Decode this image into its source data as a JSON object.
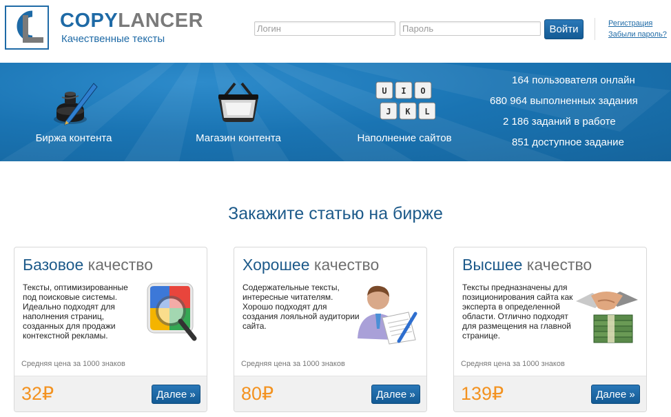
{
  "header": {
    "logo_part1": "COPY",
    "logo_part2": "LANCER",
    "tagline": "Качественные тексты",
    "login_placeholder": "Логин",
    "password_placeholder": "Пароль",
    "login_button": "Войти",
    "register_link": "Регистрация",
    "forgot_link": "Забыли пароль?"
  },
  "banner": {
    "features": [
      {
        "label": "Биржа контента",
        "icon": "inkwell-pen-icon"
      },
      {
        "label": "Магазин контента",
        "icon": "basket-icon"
      },
      {
        "label": "Наполнение сайтов",
        "icon": "keyboard-keys-icon"
      }
    ],
    "keys_top": [
      "U",
      "I",
      "O"
    ],
    "keys_bottom": [
      "J",
      "K",
      "L"
    ],
    "stats": [
      "164 пользователя онлайн",
      "680 964 выполненных задания",
      "2 186 заданий в работе",
      "851 доступное задание"
    ]
  },
  "section_title": "Закажите статью на бирже",
  "cards": [
    {
      "title_main": "Базовое",
      "title_rest": " качество",
      "description": "Тексты, оптимизированные под поисковые системы. Идеально подходят для наполнения страниц, созданных для продажи контекстной рекламы.",
      "price_label": "Средняя цена за 1000 знаков",
      "price": "32₽",
      "button": "Далее »",
      "icon": "search-engine-icon"
    },
    {
      "title_main": "Хорошее",
      "title_rest": " качество",
      "description": "Содержательные тексты, интересные читателям. Хорошо подходят для создания лояльной аудитории сайта.",
      "price_label": "Средняя цена за 1000 знаков",
      "price": "80₽",
      "button": "Далее »",
      "icon": "writer-icon"
    },
    {
      "title_main": "Высшее",
      "title_rest": " качество",
      "description": "Тексты предназначены для позиционирования сайта как эксперта в определенной области. Отлично подходят для размещения на главной странице.",
      "price_label": "Средняя цена за 1000 знаков",
      "price": "139₽",
      "button": "Далее »",
      "icon": "handshake-money-icon"
    }
  ],
  "colors": {
    "brand_blue": "#1e6aa6",
    "banner_blue": "#1a74b3",
    "price_orange": "#f39220",
    "title_blue": "#1d5a8a"
  }
}
